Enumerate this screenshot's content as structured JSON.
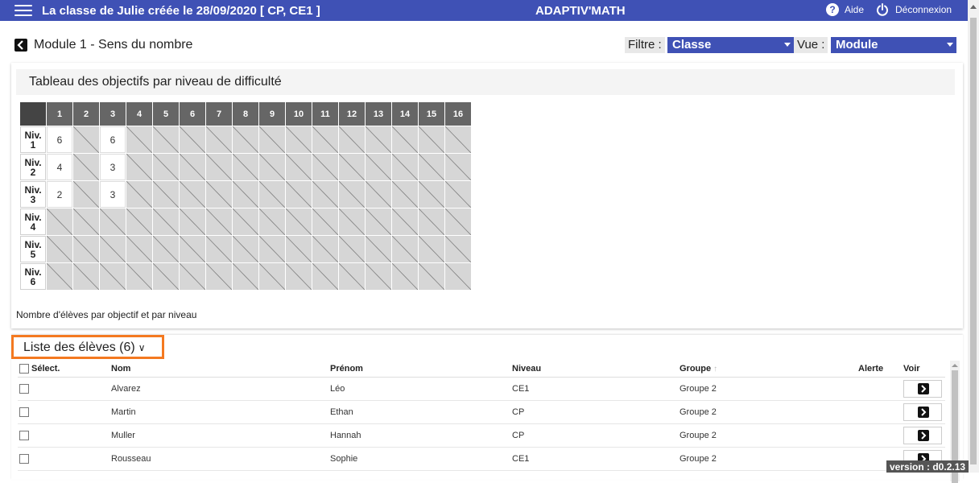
{
  "topbar": {
    "title": "La classe de Julie créée le 28/09/2020 [ CP, CE1 ]",
    "app_name": "ADAPTIV'MATH",
    "help_label": "Aide",
    "logout_label": "Déconnexion",
    "menu_icon": "hamburger-menu-icon",
    "help_icon": "question-circle-icon",
    "logout_icon": "power-icon",
    "color": "#3f51b5"
  },
  "subbar": {
    "module_title": "Module 1 - Sens du nombre",
    "filter_label": "Filtre :",
    "filter_value": "Classe",
    "view_label": "Vue :",
    "view_value": "Module",
    "back_icon": "chevron-left-icon"
  },
  "objectives": {
    "title": "Tableau des objectifs par niveau de difficulté",
    "columns": [
      "1",
      "2",
      "3",
      "4",
      "5",
      "6",
      "7",
      "8",
      "9",
      "10",
      "11",
      "12",
      "13",
      "14",
      "15",
      "16"
    ],
    "rows": [
      {
        "level": "Niv.",
        "num": "1",
        "cells": [
          "6",
          "",
          "6",
          "",
          "",
          "",
          "",
          "",
          "",
          "",
          "",
          "",
          "",
          "",
          "",
          ""
        ]
      },
      {
        "level": "Niv.",
        "num": "2",
        "cells": [
          "4",
          "",
          "3",
          "",
          "",
          "",
          "",
          "",
          "",
          "",
          "",
          "",
          "",
          "",
          "",
          ""
        ]
      },
      {
        "level": "Niv.",
        "num": "3",
        "cells": [
          "2",
          "",
          "3",
          "",
          "",
          "",
          "",
          "",
          "",
          "",
          "",
          "",
          "",
          "",
          "",
          ""
        ]
      },
      {
        "level": "Niv.",
        "num": "4",
        "cells": [
          "",
          "",
          "",
          "",
          "",
          "",
          "",
          "",
          "",
          "",
          "",
          "",
          "",
          "",
          "",
          ""
        ]
      },
      {
        "level": "Niv.",
        "num": "5",
        "cells": [
          "",
          "",
          "",
          "",
          "",
          "",
          "",
          "",
          "",
          "",
          "",
          "",
          "",
          "",
          "",
          ""
        ]
      },
      {
        "level": "Niv.",
        "num": "6",
        "cells": [
          "",
          "",
          "",
          "",
          "",
          "",
          "",
          "",
          "",
          "",
          "",
          "",
          "",
          "",
          "",
          ""
        ]
      }
    ],
    "footer": "Nombre d'élèves par objectif et par niveau"
  },
  "students": {
    "title": "Liste des élèves (6)",
    "highlight_color": "#f47920",
    "headers": {
      "select": "Sélect.",
      "nom": "Nom",
      "prenom": "Prénom",
      "niveau": "Niveau",
      "groupe": "Groupe",
      "alerte": "Alerte",
      "voir": "Voir"
    },
    "rows": [
      {
        "nom": "Alvarez",
        "prenom": "Léo",
        "niveau": "CE1",
        "groupe": "Groupe 2",
        "alerte": ""
      },
      {
        "nom": "Martin",
        "prenom": "Ethan",
        "niveau": "CP",
        "groupe": "Groupe 2",
        "alerte": ""
      },
      {
        "nom": "Muller",
        "prenom": "Hannah",
        "niveau": "CP",
        "groupe": "Groupe 2",
        "alerte": ""
      },
      {
        "nom": "Rousseau",
        "prenom": "Sophie",
        "niveau": "CE1",
        "groupe": "Groupe 2",
        "alerte": ""
      }
    ]
  },
  "version": "version : d0.2.13"
}
